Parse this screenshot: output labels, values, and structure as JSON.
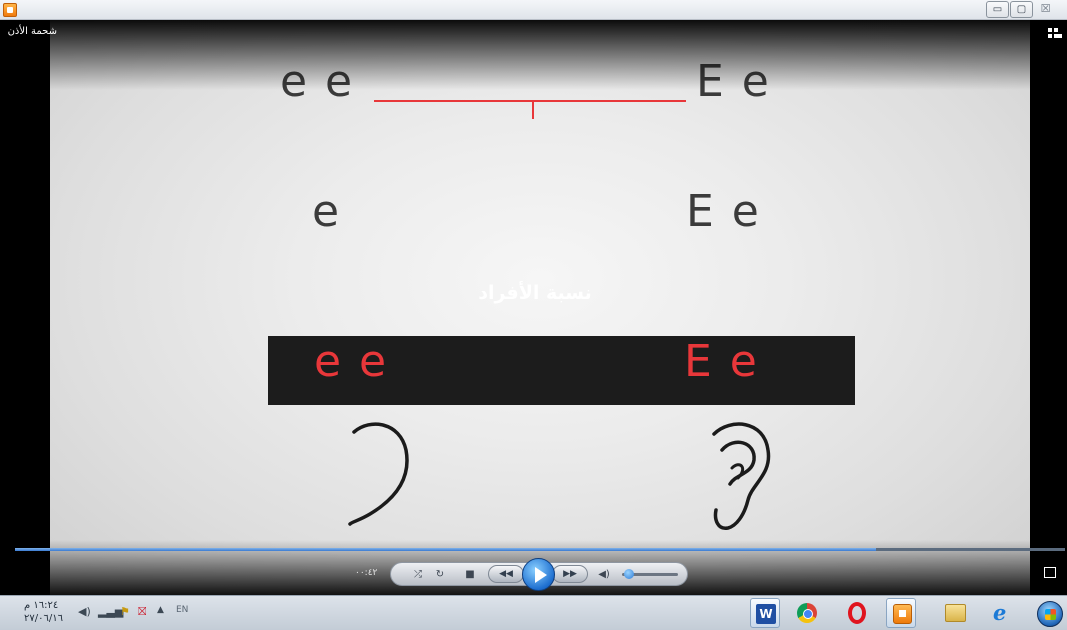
{
  "window": {
    "minimize_label": "▭",
    "maximize_label": "▢",
    "close_label": "☒"
  },
  "video": {
    "title": "شحمة الأذن",
    "top_left_text": "e e",
    "top_right_text": "E e",
    "mid_left_text": "e",
    "mid_right_text": "E e",
    "overlay_text": "نسبة الأفراد",
    "band_left_text": "e e",
    "band_right_text": "E e",
    "accent_color": "#e8373a"
  },
  "player": {
    "elapsed_time": "٠٠:٤٢",
    "progress_fraction": 0.82,
    "volume_fraction": 0.05,
    "shuffle_label": "⤮",
    "repeat_label": "↻",
    "stop_label": "■",
    "prev_label": "◀◀",
    "next_label": "▶▶",
    "mute_label": "◀)"
  },
  "taskbar": {
    "clock_time": "١٦:٢٤ م",
    "clock_date": "٢٧/٠٦/١٦",
    "language": "EN",
    "apps": [
      "word-icon",
      "chrome-icon",
      "opera-icon",
      "media-player-icon",
      "file-explorer-icon",
      "internet-explorer-icon",
      "start-icon"
    ],
    "word_letter": "W"
  }
}
